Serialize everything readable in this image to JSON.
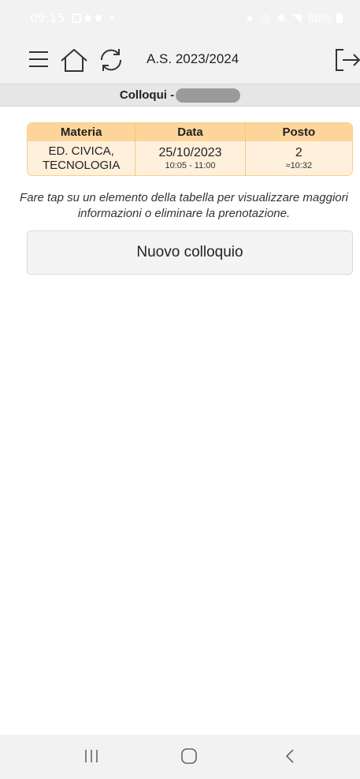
{
  "status_bar": {
    "time": "09:15",
    "battery": "86%"
  },
  "header": {
    "school_year": "A.S. 2023/2024",
    "icons": [
      "menu-icon",
      "home-icon",
      "refresh-icon",
      "logout-icon"
    ]
  },
  "title": {
    "label": "Colloqui -"
  },
  "table": {
    "headers": [
      "Materia",
      "Data",
      "Posto"
    ],
    "rows": [
      {
        "materia_line1": "ED. CIVICA,",
        "materia_line2": "TECNOLOGIA",
        "data_date": "25/10/2023",
        "data_time": "10:05 - 11:00",
        "posto_number": "2",
        "posto_time": "≈10:32"
      }
    ]
  },
  "hint": "Fare tap su un elemento della tabella per visualizzare maggiori informazioni o eliminare la prenotazione.",
  "new_button": "Nuovo colloquio",
  "colors": {
    "header_bg": "#f2f2f2",
    "table_header": "#fdd59a",
    "table_row": "#fff0dc"
  }
}
